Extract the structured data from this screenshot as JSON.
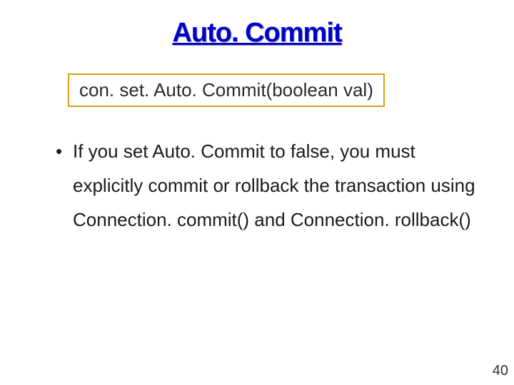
{
  "title": "Auto. Commit",
  "code_box": "con. set. Auto. Commit(boolean val)",
  "bullets": [
    "If you set Auto. Commit to false, you must explicitly commit or rollback the transaction using Connection. commit() and Connection. rollback()"
  ],
  "page_number": "40"
}
